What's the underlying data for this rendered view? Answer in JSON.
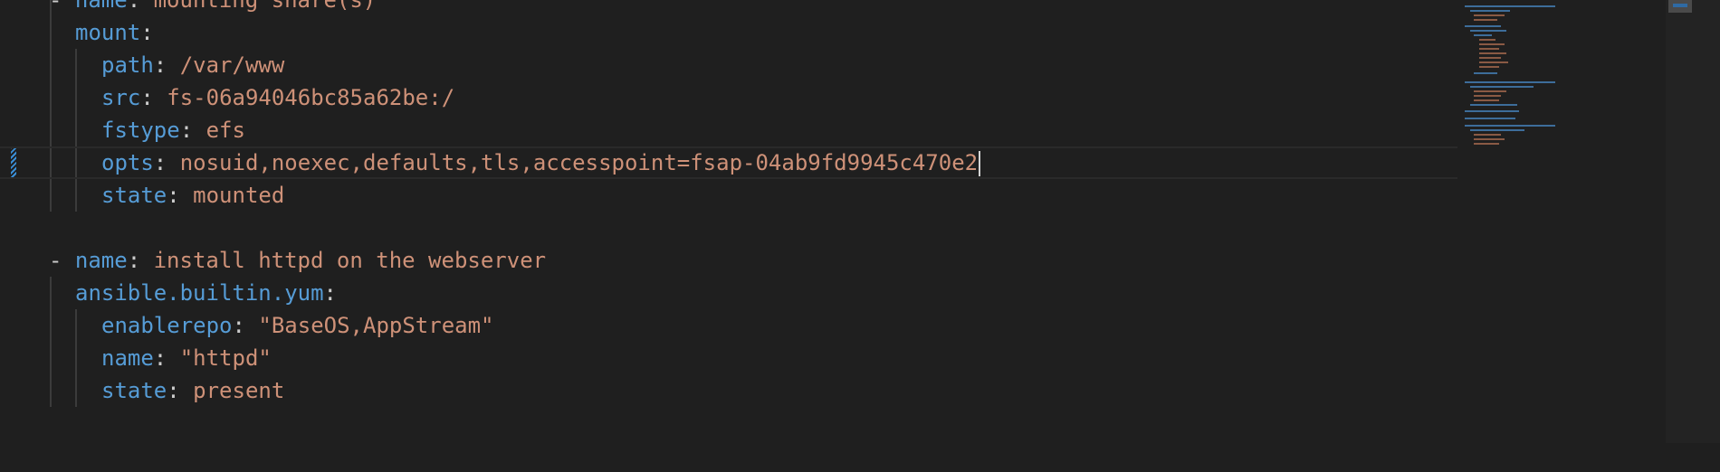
{
  "editor": {
    "lines": [
      {
        "dash": "- ",
        "key": "name",
        "sep": ": ",
        "value": "mounting share(s)"
      },
      {
        "key": "mount",
        "sep": ":",
        "value": ""
      },
      {
        "key": "path",
        "sep": ": ",
        "value": "/var/www"
      },
      {
        "key": "src",
        "sep": ": ",
        "value": "fs-06a94046bc85a62be:/"
      },
      {
        "key": "fstype",
        "sep": ": ",
        "value": "efs"
      },
      {
        "key": "opts",
        "sep": ": ",
        "value": "nosuid,noexec,defaults,tls,accesspoint=fsap-04ab9fd9945c470e2"
      },
      {
        "key": "state",
        "sep": ": ",
        "value": "mounted"
      },
      {
        "key": "",
        "sep": "",
        "value": ""
      },
      {
        "dash": "- ",
        "key": "name",
        "sep": ": ",
        "value": "install httpd on the webserver"
      },
      {
        "key": "ansible.builtin.yum",
        "sep": ":",
        "value": ""
      },
      {
        "key": "enablerepo",
        "sep": ": ",
        "value": "\"BaseOS,AppStream\""
      },
      {
        "key": "name",
        "sep": ": ",
        "value": "\"httpd\""
      },
      {
        "key": "state",
        "sep": ": ",
        "value": "present"
      }
    ]
  },
  "colors": {
    "background": "#1f1f1f",
    "key": "#569cd6",
    "value": "#ce9178",
    "punctuation": "#cccccc",
    "modified_gutter": "#3a8fd8"
  }
}
